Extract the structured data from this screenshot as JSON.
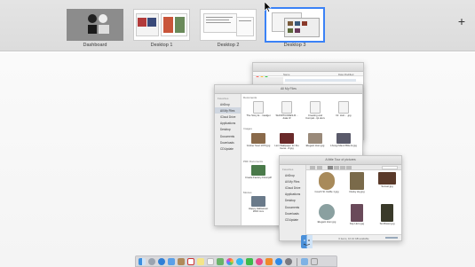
{
  "spaces": [
    {
      "label": "Dashboard"
    },
    {
      "label": "Desktop 1"
    },
    {
      "label": "Desktop 2"
    },
    {
      "label": "Desktop 3"
    }
  ],
  "add_space_symbol": "+",
  "back_window": {
    "columns": [
      "Name",
      "Date Modified"
    ]
  },
  "main_window": {
    "title": "All My Files",
    "sidebar_sections": [
      "Favorites"
    ],
    "sidebar_items": [
      "AirDrop",
      "All My Files",
      "iCloud Drive",
      "Applications",
      "Desktop",
      "Documents",
      "Downloads",
      "CDUpdate"
    ],
    "group_labels": [
      "Documents",
      "Images",
      "PDF Documents",
      "Movies"
    ],
    "files": [
      "The Story E...  Gadget",
      "SHORTCODES-R...  data.rtf",
      "Creating and Compat...ipt.docx",
      "Dr. Huir... .jpg",
      "Gruber Soul 1976.jpg",
      "Lion Wallpaper for the Gene...Z.jpg",
      "Elegant Hom.jpg",
      "Lhoogi Mand Bitte E.jpg",
      "Create Factory Final.pdf",
      "Happy Halloween 2016.mov"
    ]
  },
  "front_window": {
    "title": "A little Tour of pictures",
    "sidebar_sections": [
      "Favorites"
    ],
    "sidebar_items": [
      "AirDrop",
      "All My Files",
      "iCloud Drive",
      "Applications",
      "Desktop",
      "Documents",
      "Downloads",
      "CDUpdate"
    ],
    "files": [
      "Couch Sl. Dolfie 1.jpg",
      "Dusky sky.jpg",
      "Sunset.jpg",
      "Elegant Hom.jpg",
      "Kay Hero.jpg",
      "Sunflower.jpg"
    ],
    "status": "6 items, 16.44 GB available"
  },
  "dock": {
    "icons": [
      "finder-icon",
      "launchpad-icon",
      "safari-icon",
      "mail-icon",
      "contacts-icon",
      "calendar-icon",
      "notes-icon",
      "reminders-icon",
      "maps-icon",
      "photos-icon",
      "messages-icon",
      "facetime-icon",
      "itunes-icon",
      "ibooks-icon",
      "app-store-icon",
      "system-preferences-icon",
      "downloads-folder-icon",
      "trash-icon"
    ]
  }
}
